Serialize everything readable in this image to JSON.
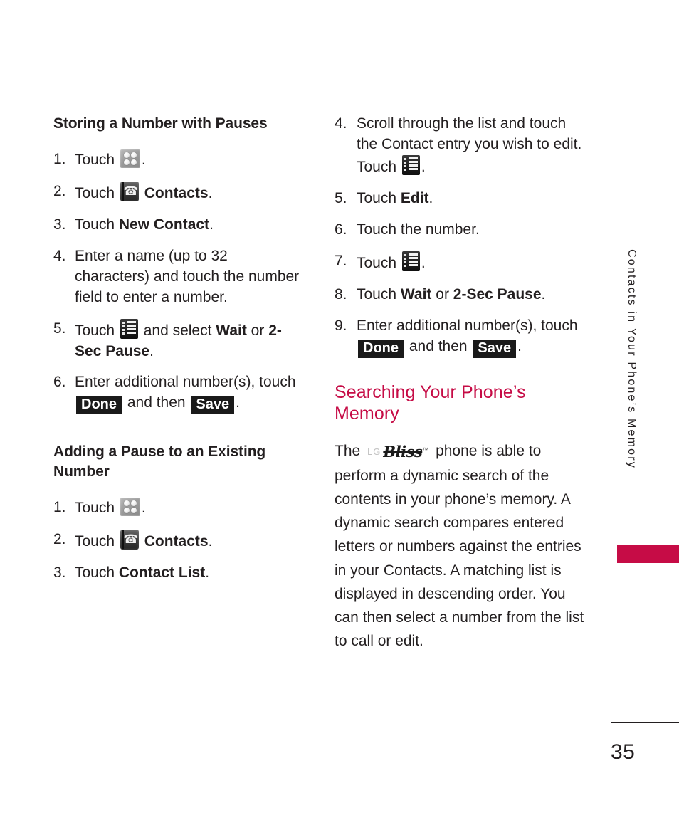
{
  "page": {
    "number": "35",
    "side_tab_label": "Contacts in Your Phone’s Memory",
    "accent_color": "#c60c46"
  },
  "left_column": {
    "section1": {
      "heading": "Storing a Number with Pauses",
      "steps": [
        {
          "num": "1.",
          "pre": "Touch ",
          "icon": "grid-icon",
          "post": "."
        },
        {
          "num": "2.",
          "pre": "Touch ",
          "icon": "contacts-phone-icon",
          "bold": "Contacts",
          "post": "."
        },
        {
          "num": "3.",
          "pre": "Touch ",
          "bold": "New Contact",
          "post": "."
        },
        {
          "num": "4.",
          "pre": "Enter a name (up to 32 characters) and touch the number field to enter a number."
        },
        {
          "num": "5.",
          "pre": "Touch ",
          "icon": "list-menu-icon",
          "mid": " and select ",
          "bold": "Wait",
          "mid2": " or ",
          "bold2": "2-Sec Pause",
          "post": "."
        },
        {
          "num": "6.",
          "pre": "Enter additional number(s), touch ",
          "badge1": "Done",
          "mid": " and then ",
          "badge2": "Save",
          "post": "."
        }
      ]
    },
    "section2": {
      "heading": "Adding a Pause to an Existing Number",
      "steps": [
        {
          "num": "1.",
          "pre": "Touch ",
          "icon": "grid-icon",
          "post": "."
        },
        {
          "num": "2.",
          "pre": "Touch ",
          "icon": "contacts-phone-icon",
          "bold": "Contacts",
          "post": "."
        },
        {
          "num": "3.",
          "pre": "Touch ",
          "bold": "Contact List",
          "post": "."
        }
      ]
    }
  },
  "right_column": {
    "steps": [
      {
        "num": "4.",
        "pre": "Scroll through the list and touch the Contact entry you wish to edit. Touch ",
        "icon": "list-menu-icon",
        "post": "."
      },
      {
        "num": "5.",
        "pre": "Touch ",
        "bold": "Edit",
        "post": "."
      },
      {
        "num": "6.",
        "pre": "Touch the number."
      },
      {
        "num": "7.",
        "pre": "Touch ",
        "icon": "list-menu-icon",
        "post": "."
      },
      {
        "num": "8.",
        "pre": "Touch ",
        "bold": "Wait",
        "mid": " or ",
        "bold2": "2-Sec Pause",
        "post": "."
      },
      {
        "num": "9.",
        "pre": "Enter additional number(s), touch ",
        "badge1": "Done",
        "mid": " and then ",
        "badge2": "Save",
        "post": "."
      }
    ],
    "section": {
      "heading": "Searching Your Phone’s Memory",
      "body_pre": "The ",
      "logo_lg": "LG",
      "logo_bliss": "Bliss",
      "logo_tm": "™",
      "body_post": " phone is able to perform a dynamic search of the contents in your phone’s memory. A dynamic search compares entered letters or numbers against the entries in your Contacts. A matching list is displayed in descending order. You can then select a number from the list to call or edit."
    }
  }
}
